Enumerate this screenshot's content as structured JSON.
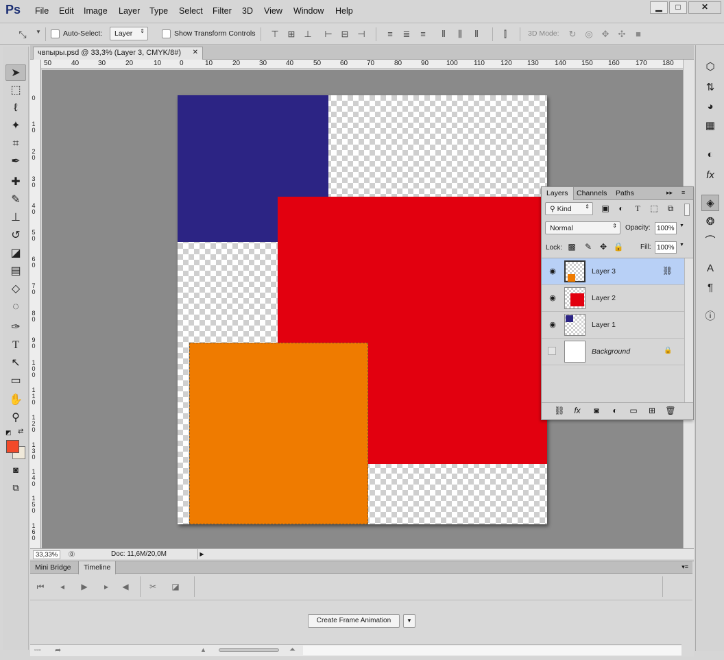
{
  "app": {
    "logo": "Ps"
  },
  "menu": [
    "File",
    "Edit",
    "Image",
    "Layer",
    "Type",
    "Select",
    "Filter",
    "3D",
    "View",
    "Window",
    "Help"
  ],
  "window_controls": {
    "minimize": "▁",
    "maximize": "□",
    "close": "✕"
  },
  "options_bar": {
    "tool_icon": "move-tool",
    "auto_select_label": "Auto-Select:",
    "auto_select_target": "Layer",
    "show_transform_label": "Show Transform Controls",
    "mode_3d_label": "3D Mode:"
  },
  "document": {
    "tab_title": "чвпыры.psd @ 33,3% (Layer 3, CMYK/8#)",
    "tab_close": "✕",
    "ruler_top": [
      "50",
      "40",
      "30",
      "20",
      "10",
      "0",
      "10",
      "20",
      "30",
      "40",
      "50",
      "60",
      "70",
      "80",
      "90",
      "100",
      "110",
      "120",
      "130",
      "140",
      "150",
      "160",
      "170",
      "180"
    ],
    "ruler_left": [
      "0",
      "1 0",
      "2 0",
      "3 0",
      "4 0",
      "5 0",
      "6 0",
      "7 0",
      "8 0",
      "9 0",
      "1 0 0",
      "1 1 0",
      "1 2 0",
      "1 3 0",
      "1 4 0",
      "1 5 0",
      "1 6 0"
    ]
  },
  "colors": {
    "layer1": "#2c2484",
    "layer2": "#e2000f",
    "layer3": "#ef7b00",
    "foreground": "#f24a2a",
    "background": "#efe8d9",
    "accent": "#b8d0f6"
  },
  "status_bar": {
    "zoom": "33,33%",
    "doc_info": "Doc: 11,6M/20,0M"
  },
  "layers_panel": {
    "tabs": [
      "Layers",
      "Channels",
      "Paths"
    ],
    "filter_kind": "Kind",
    "blend_mode": "Normal",
    "opacity_label": "Opacity:",
    "opacity_value": "100%",
    "lock_label": "Lock:",
    "fill_label": "Fill:",
    "fill_value": "100%",
    "layers": [
      {
        "name": "Layer 3",
        "selected": true
      },
      {
        "name": "Layer 2",
        "selected": false
      },
      {
        "name": "Layer 1",
        "selected": false
      },
      {
        "name": "Background",
        "selected": false
      }
    ]
  },
  "timeline_panel": {
    "tabs": [
      "Mini Bridge",
      "Timeline"
    ],
    "create_button": "Create Frame Animation"
  }
}
